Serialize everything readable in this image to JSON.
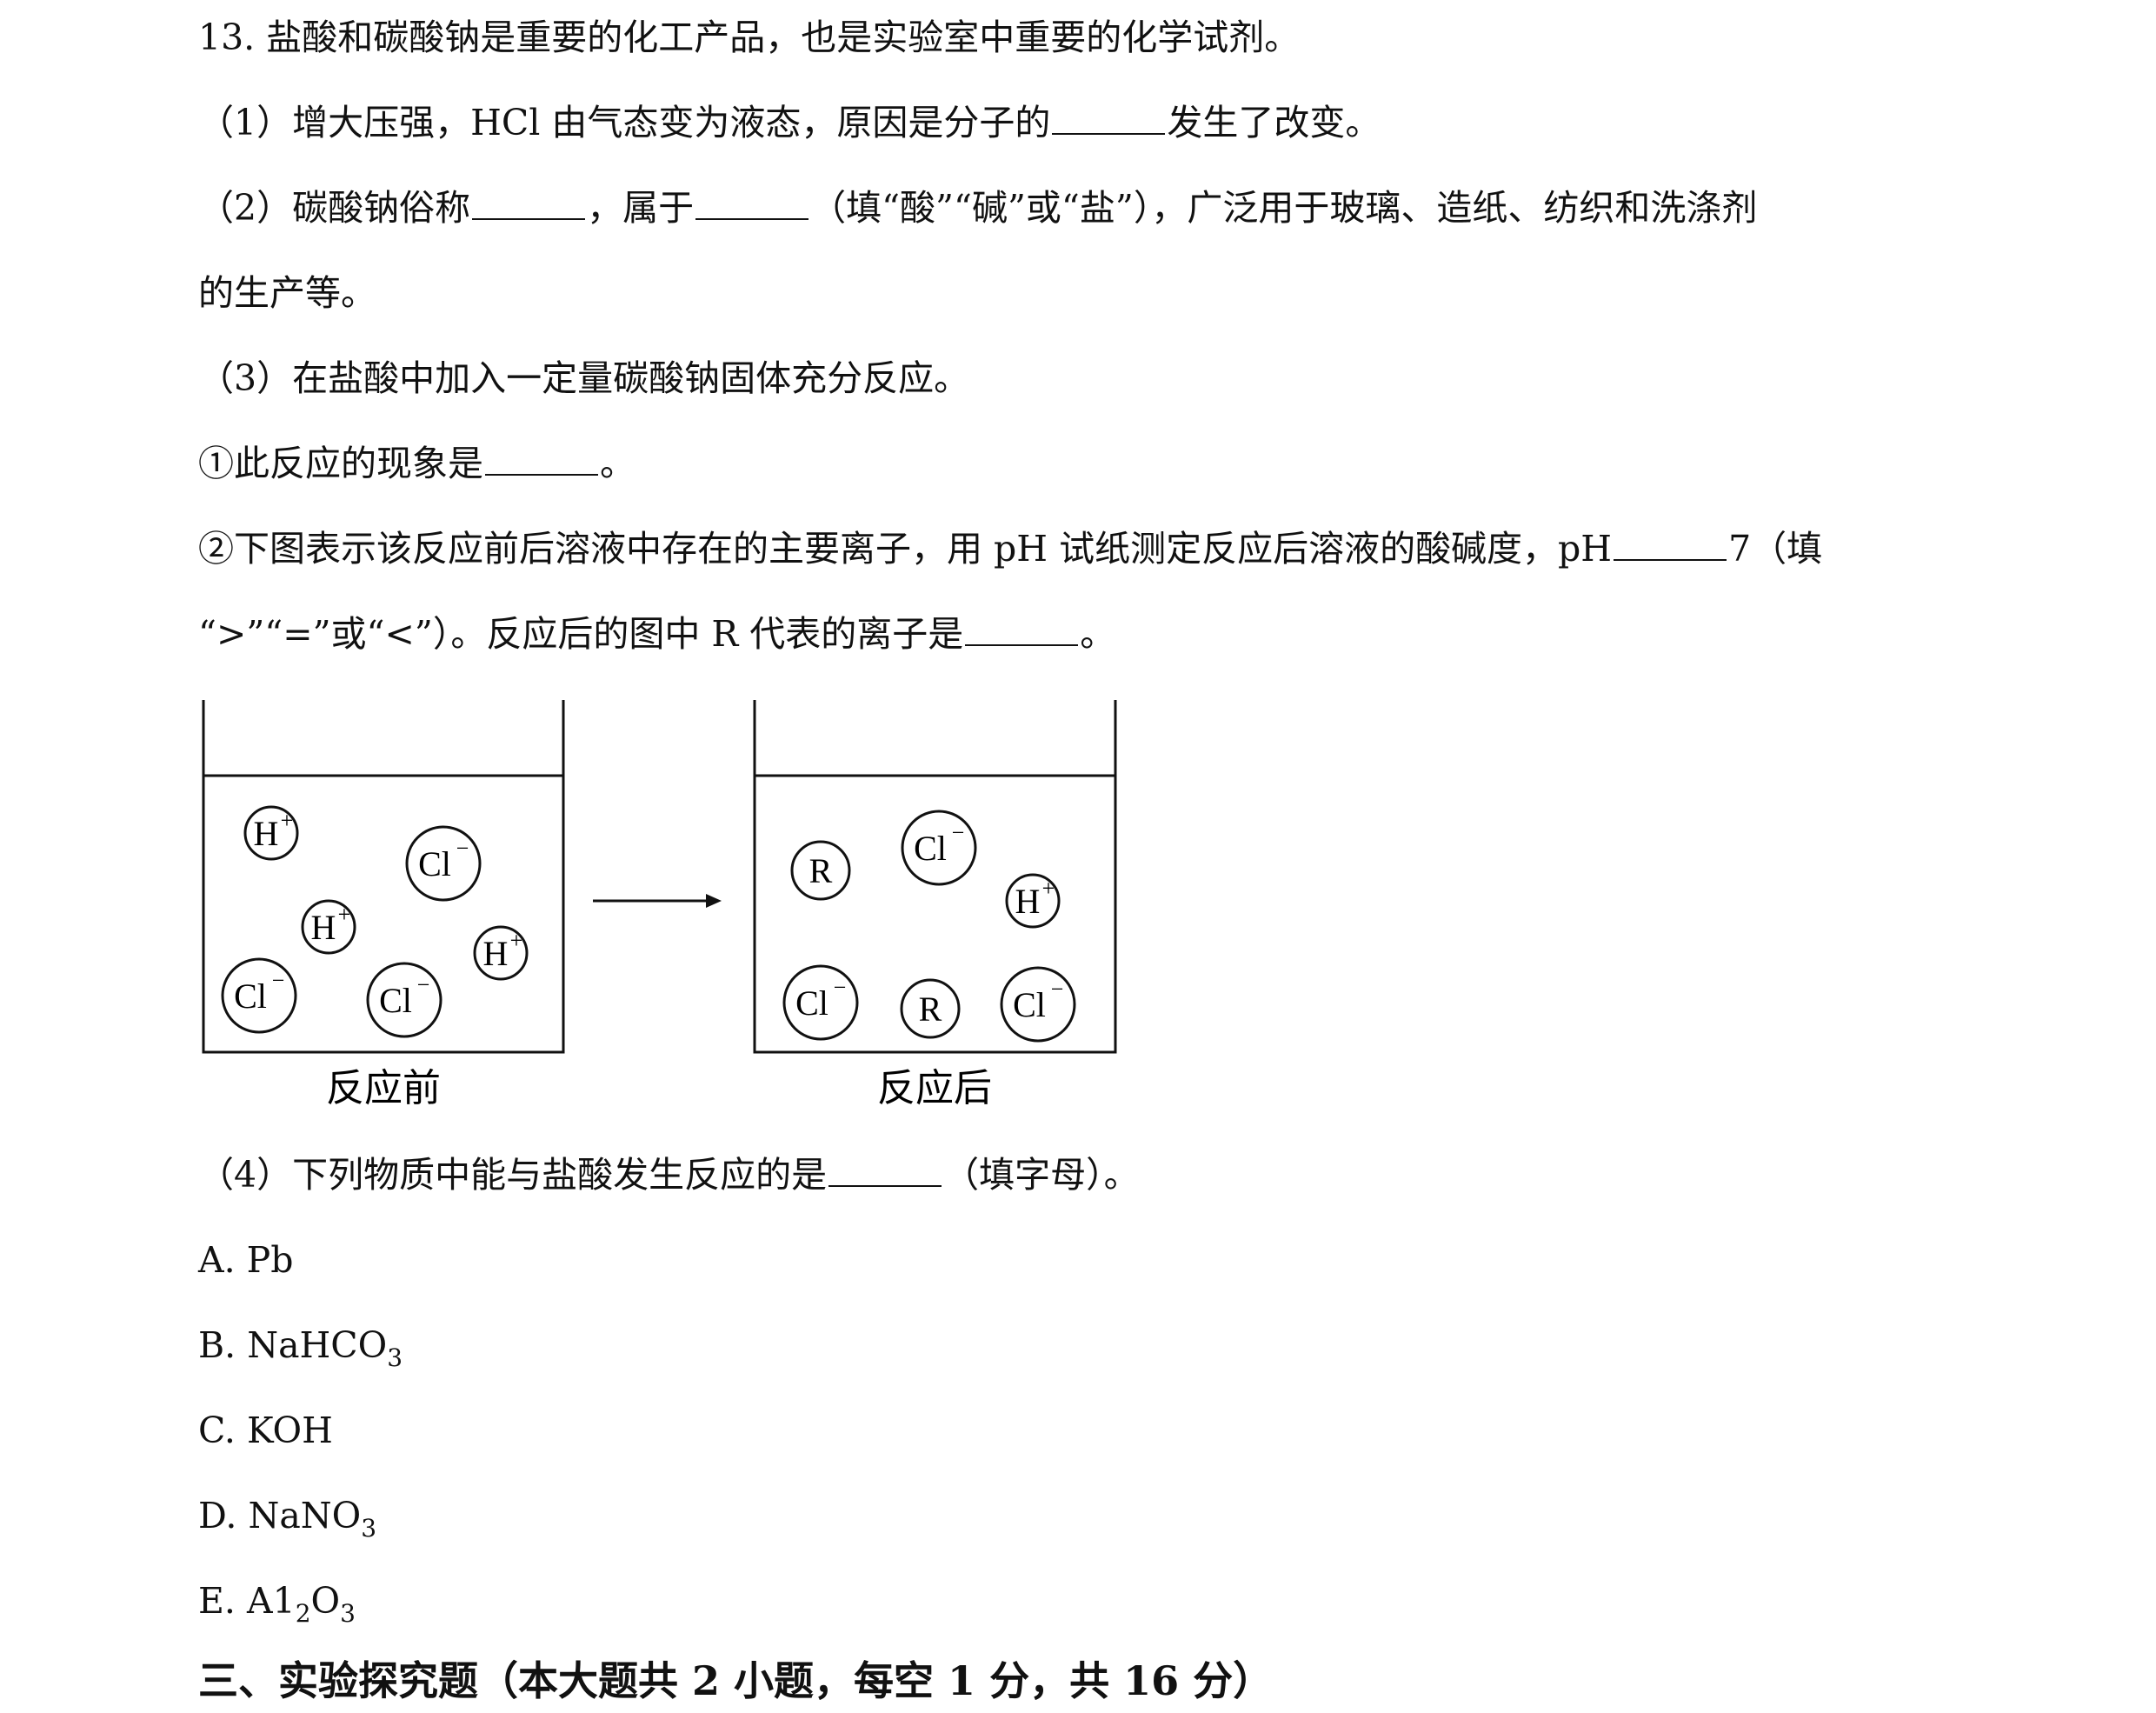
{
  "question": {
    "title": "13. 盐酸和碳酸钠是重要的化工产品，也是实验室中重要的化学试剂。",
    "q1": {
      "prefix": "（1）增大压强，HCl 由气态变为液态，原因是分子的",
      "suffix": "发生了改变。"
    },
    "q2": {
      "prefix": "（2）碳酸钠俗称",
      "middle": "，属于",
      "suffix": "（填“酸”“碱”或“盐”），广泛用于玻璃、造纸、纺织和洗涤剂",
      "continuation": "的生产等。"
    },
    "q3": {
      "intro": "（3）在盐酸中加入一定量碳酸钠固体充分反应。",
      "part1_prefix": "①此反应的现象是",
      "part1_suffix": "。",
      "part2_prefix": "②下图表示该反应前后溶液中存在的主要离子，用 pH 试纸测定反应后溶液的酸碱度，pH",
      "part2_suffix": "7（填",
      "part2_cont_prefix": "“>”“=”或“<”）。反应后的图中 R 代表的离子是",
      "part2_cont_suffix": "。"
    },
    "q4": {
      "prefix": "（4）下列物质中能与盐酸发生反应的是",
      "suffix": "（填字母）。",
      "options": {
        "a": "A. Pb",
        "b_prefix": "B. NaHCO",
        "b_sub": "3",
        "c": "C. KOH",
        "d_prefix": "D. NaNO",
        "d_sub": "3",
        "e_prefix": "E. A1",
        "e_sub1": "2",
        "e_mid": "O",
        "e_sub2": "3"
      }
    }
  },
  "diagram": {
    "before_label": "反应前",
    "after_label": "反应后",
    "ion_h": "H",
    "ion_cl": "Cl",
    "plus": "+",
    "minus": "−",
    "ion_r": "R"
  },
  "section_heading": "三、实验探究题（本大题共 2 小题，每空 1 分，共 16 分）"
}
